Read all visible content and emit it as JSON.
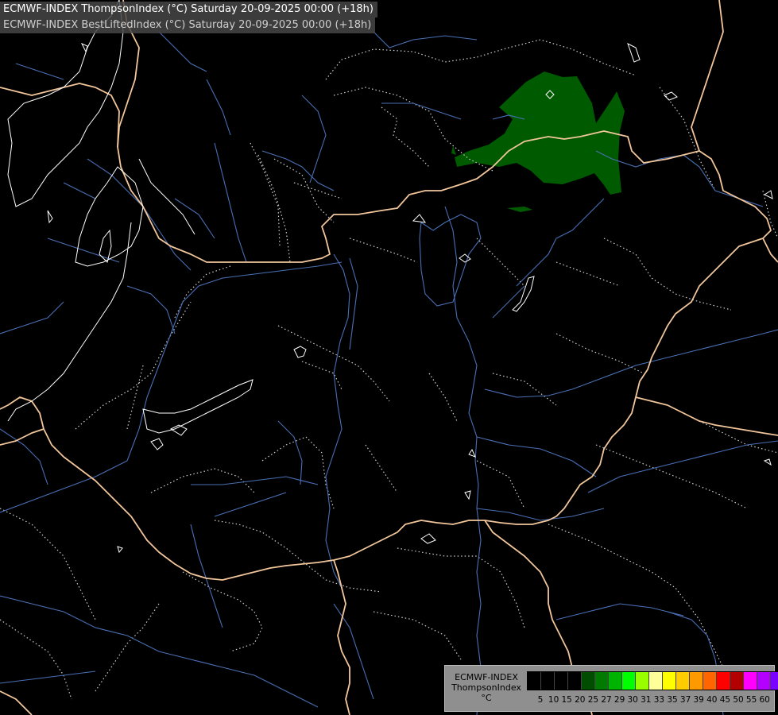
{
  "header": {
    "title_primary": "ECMWF-INDEX ThompsonIndex (°C) Saturday 20-09-2025 00:00 (+18h)",
    "title_secondary": "ECMWF-INDEX BestLiftedIndex (°C) Saturday 20-09-2025 00:00 (+18h)"
  },
  "legend": {
    "line1": "ECMWF-INDEX",
    "line2": "ThompsonIndex",
    "line3": "°C",
    "colors": [
      "#000000",
      "#000000",
      "#000000",
      "#000000",
      "#004d00",
      "#007a00",
      "#00b300",
      "#00ff00",
      "#99ff00",
      "#ffff99",
      "#ffff00",
      "#ffcc00",
      "#ff9900",
      "#ff6600",
      "#ff0000",
      "#b30000",
      "#ff00ff",
      "#b300ff",
      "#7a00ff",
      "#3300ff",
      "#0000ff"
    ],
    "ticks": [
      "5",
      "10",
      "15",
      "20",
      "25",
      "27",
      "29",
      "30",
      "31",
      "33",
      "35",
      "37",
      "39",
      "40",
      "45",
      "50",
      "55",
      "60"
    ]
  },
  "map": {
    "colors": {
      "background": "#000000",
      "border": "#f2c69b",
      "river": "#4a6fb5",
      "lake_outline": "#ffffff",
      "isoline": "#d0d0d0",
      "instability_fill": "#005a00"
    }
  }
}
